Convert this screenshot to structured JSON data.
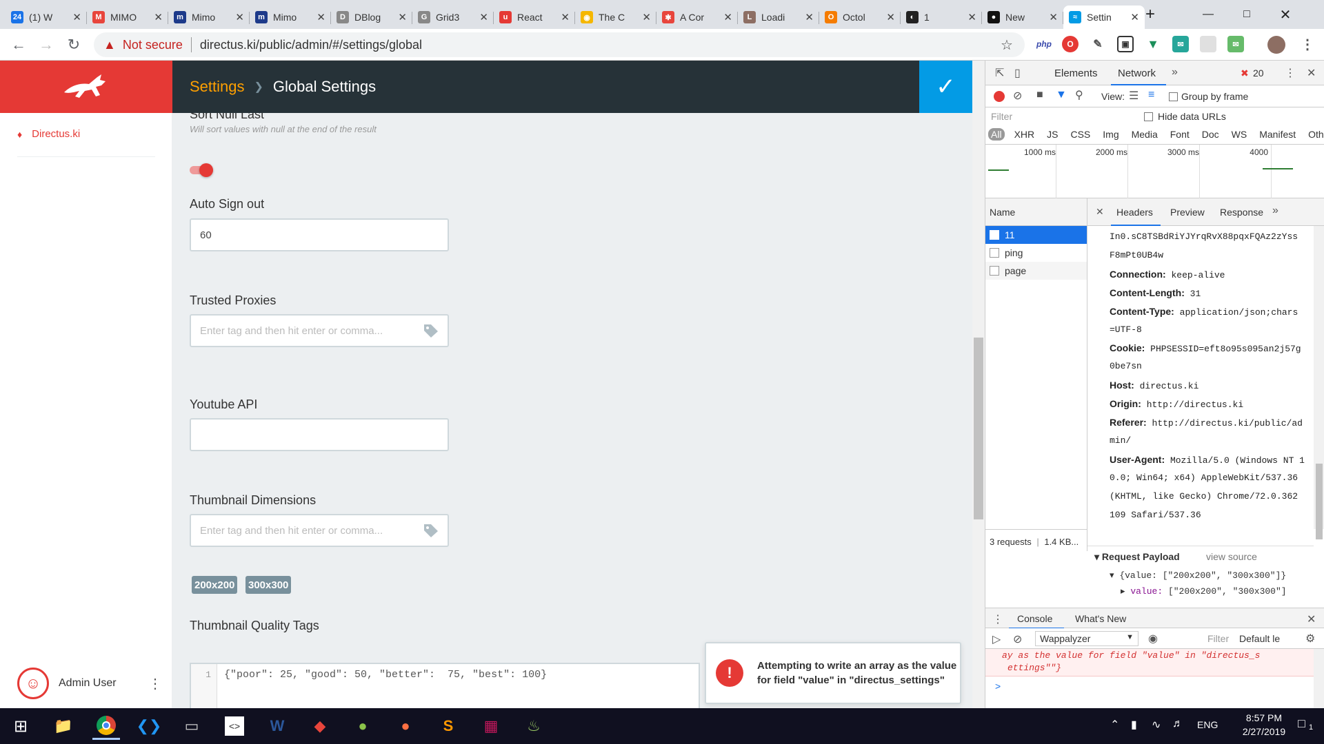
{
  "browser": {
    "tabs": [
      {
        "label": "(1) W",
        "fav": "24",
        "color": "#1a73e8"
      },
      {
        "label": "MIMO",
        "fav": "M",
        "color": "#e8453c"
      },
      {
        "label": "Mimo",
        "fav": "m",
        "color": "#1d3a8a"
      },
      {
        "label": "Mimo",
        "fav": "m",
        "color": "#1d3a8a"
      },
      {
        "label": "DBlog",
        "fav": "D",
        "color": "#888888"
      },
      {
        "label": "Grid3",
        "fav": "G",
        "color": "#888888"
      },
      {
        "label": "React",
        "fav": "u",
        "color": "#e53935"
      },
      {
        "label": "The C",
        "fav": "◉",
        "color": "#f5b700"
      },
      {
        "label": "A Cor",
        "fav": "✱",
        "color": "#e8453c"
      },
      {
        "label": "Loadi",
        "fav": "L",
        "color": "#8d6e63"
      },
      {
        "label": "Octol",
        "fav": "O",
        "color": "#f57c00"
      },
      {
        "label": "1",
        "fav": "◐",
        "color": "#222222"
      },
      {
        "label": "New",
        "fav": "●",
        "color": "#111111"
      },
      {
        "label": "Settin",
        "fav": "≈",
        "color": "#039be5"
      }
    ],
    "new_tab": "+",
    "not_secure": "Not secure",
    "url": "directus.ki/public/admin/#/settings/global"
  },
  "app": {
    "breadcrumb": "Settings",
    "title": "Global Settings",
    "project": "Directus.ki",
    "user": "Admin User",
    "fields": {
      "sort_null_label": "Sort Null Last",
      "sort_null_note": "Will sort values with null at the end of the result",
      "auto_signout_label": "Auto Sign out",
      "auto_signout_value": "60",
      "trusted_proxies_label": "Trusted Proxies",
      "tag_placeholder": "Enter tag and then hit enter or comma...",
      "youtube_label": "Youtube API",
      "thumb_dims_label": "Thumbnail Dimensions",
      "thumb_dims_tags": [
        "200x200",
        "300x300"
      ],
      "thumb_quality_label": "Thumbnail Quality Tags",
      "code_line": "1",
      "code_value": "{\"poor\": 25, \"good\": 50, \"better\":  75, \"best\": 100}"
    },
    "toast": "Attempting to write an array as the value for field \"value\" in \"directus_settings\""
  },
  "devtools": {
    "tabs": [
      "Elements",
      "Network"
    ],
    "error_count": "20",
    "view_label": "View:",
    "group_by_frame": "Group by frame",
    "filter_placeholder": "Filter",
    "hide_data_urls": "Hide data URLs",
    "type_filters": [
      "All",
      "XHR",
      "JS",
      "CSS",
      "Img",
      "Media",
      "Font",
      "Doc",
      "WS",
      "Manifest",
      "Other"
    ],
    "timeline": [
      "1000 ms",
      "2000 ms",
      "3000 ms",
      "4000"
    ],
    "name_col": "Name",
    "requests": [
      "11",
      "ping",
      "page"
    ],
    "detail_tabs": [
      "Headers",
      "Preview",
      "Response"
    ],
    "headers": [
      {
        "k": "",
        "v": "In0.sC8TSBdRiYJYrqRvX88pqxFQAz2zYss"
      },
      {
        "k": "",
        "v": "F8mPt0UB4w"
      },
      {
        "k": "Connection:",
        "v": "keep-alive"
      },
      {
        "k": "Content-Length:",
        "v": "31"
      },
      {
        "k": "Content-Type:",
        "v": "application/json;chars"
      },
      {
        "k": "",
        "v": "=UTF-8"
      },
      {
        "k": "Cookie:",
        "v": "PHPSESSID=eft8o95s095an2j57g"
      },
      {
        "k": "",
        "v": "0be7sn"
      },
      {
        "k": "Host:",
        "v": "directus.ki"
      },
      {
        "k": "Origin:",
        "v": "http://directus.ki"
      },
      {
        "k": "Referer:",
        "v": "http://directus.ki/public/ad"
      },
      {
        "k": "",
        "v": "min/"
      },
      {
        "k": "User-Agent:",
        "v": "Mozilla/5.0 (Windows NT 1"
      },
      {
        "k": "",
        "v": "0.0; Win64; x64) AppleWebKit/537.36"
      },
      {
        "k": "",
        "v": "(KHTML, like Gecko) Chrome/72.0.362"
      },
      {
        "k": "",
        "v": "109 Safari/537.36"
      }
    ],
    "payload_label": "Request Payload",
    "view_source": "view source",
    "payload_line1": "{value: [\"200x200\", \"300x300\"]}",
    "payload_key": "value:",
    "payload_val": "[\"200x200\", \"300x300\"]",
    "status": "3 requests",
    "status_size": "1.4 KB...",
    "drawer_tabs": [
      "Console",
      "What's New"
    ],
    "context": "Wappalyzer",
    "console_filter": "Filter",
    "levels": "Default le",
    "console_msg1": "ay as the value for field \"value\" in \"directus_s",
    "console_msg2": "ettings\"\"}",
    "prompt": ">"
  },
  "taskbar": {
    "lang": "ENG",
    "time": "8:57 PM",
    "date": "2/27/2019",
    "notif": "1"
  }
}
